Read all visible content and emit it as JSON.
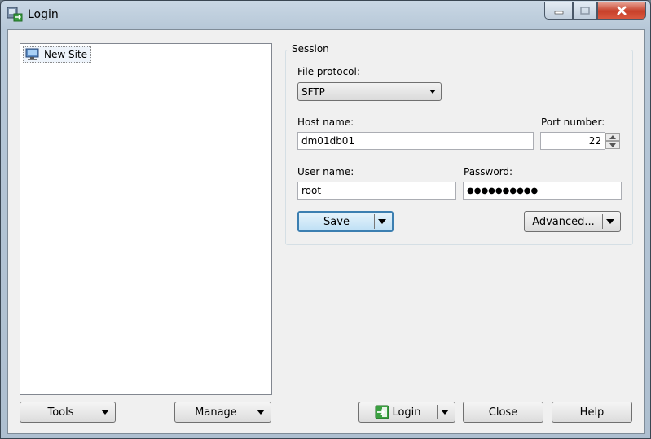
{
  "window": {
    "title": "Login"
  },
  "sites": {
    "items": [
      {
        "label": "New Site"
      }
    ]
  },
  "session": {
    "group_label": "Session",
    "file_protocol": {
      "label": "File protocol:",
      "value": "SFTP"
    },
    "host": {
      "label": "Host name:",
      "value": "dm01db01"
    },
    "port": {
      "label": "Port number:",
      "value": "22"
    },
    "user": {
      "label": "User name:",
      "value": "root"
    },
    "password": {
      "label": "Password:",
      "value": "●●●●●●●●●●"
    },
    "save_label": "Save",
    "advanced_label": "Advanced..."
  },
  "footer": {
    "tools_label": "Tools",
    "manage_label": "Manage",
    "login_label": "Login",
    "close_label": "Close",
    "help_label": "Help"
  }
}
